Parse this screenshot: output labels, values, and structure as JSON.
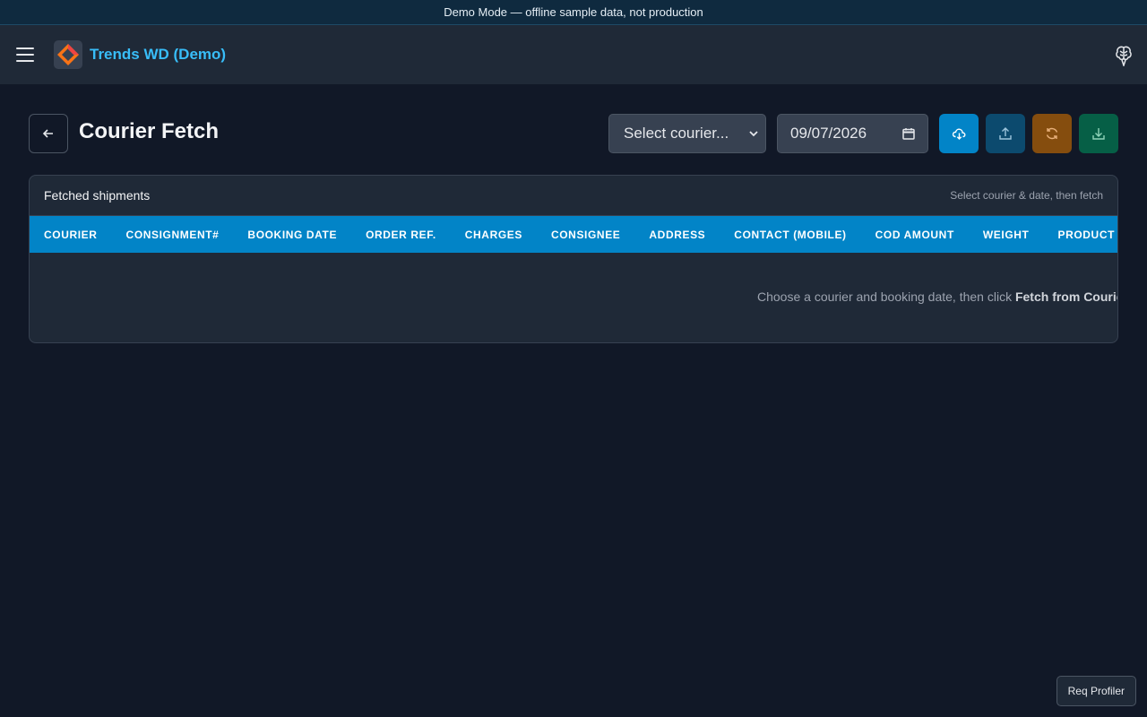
{
  "banner": {
    "text": "Demo Mode — offline sample data, not production"
  },
  "header": {
    "app_title": "Trends WD (Demo)"
  },
  "page": {
    "title": "Courier Fetch",
    "courier_select": {
      "value": "Select courier..."
    },
    "date_input": {
      "value": "09/07/2026"
    }
  },
  "card": {
    "title": "Fetched shipments",
    "hint": "Select courier & date, then fetch",
    "columns": [
      "COURIER",
      "CONSIGNMENT#",
      "BOOKING DATE",
      "ORDER REF.",
      "CHARGES",
      "CONSIGNEE",
      "ADDRESS",
      "CONTACT (MOBILE)",
      "COD AMOUNT",
      "WEIGHT",
      "PRODUCT DESCRIPTION"
    ],
    "empty_prefix": "Choose a courier and booking date, then click ",
    "empty_action": "Fetch from Courier"
  },
  "footer": {
    "profiler_label": "Req Profiler"
  },
  "colors": {
    "accent": "#0284c7",
    "title_link": "#38bdf8",
    "refresh": "#854d0e",
    "download": "#065f46"
  }
}
